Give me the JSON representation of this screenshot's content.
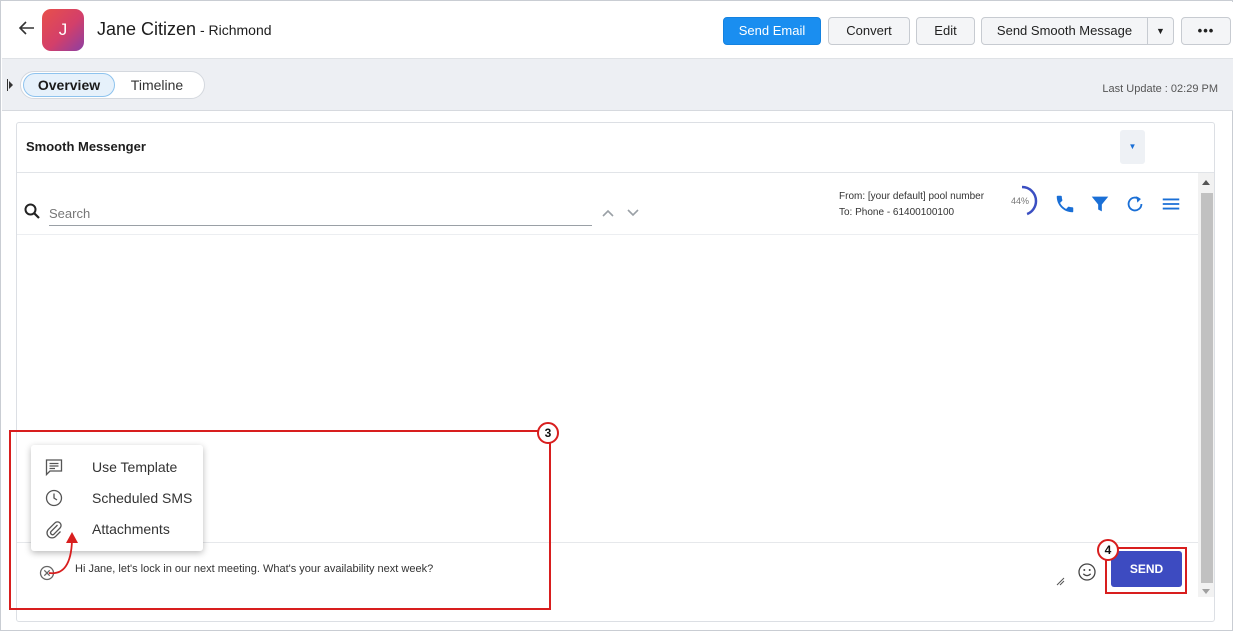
{
  "header": {
    "back_icon": "arrow-left-icon",
    "avatar_letter": "J",
    "contact_name": "Jane Citizen",
    "contact_location": " - Richmond",
    "buttons": {
      "send_email": "Send Email",
      "convert": "Convert",
      "edit": "Edit",
      "send_smooth_message": "Send Smooth Message",
      "more": "•••"
    },
    "accent_color": "#1a8ef0"
  },
  "tabs": {
    "items": [
      "Overview",
      "Timeline"
    ],
    "active": "Overview",
    "last_update": "Last Update : 02:29 PM"
  },
  "messenger": {
    "title": "Smooth Messenger",
    "search_placeholder": "Search",
    "from": "From: [your default] pool number",
    "to": "To: Phone - 61400100100",
    "progress_percent": 44,
    "progress_label": "44%",
    "tool_icons": [
      "phone-icon",
      "filter-icon",
      "refresh-icon",
      "menu-icon"
    ],
    "message_text": "Hi Jane, let's lock in our next meeting. What's your availability next week?",
    "send_label": "SEND",
    "send_color": "#3d4bc1"
  },
  "popup_menu": {
    "items": [
      {
        "label": "Use Template",
        "icon": "template-icon"
      },
      {
        "label": "Scheduled SMS",
        "icon": "clock-icon"
      },
      {
        "label": "Attachments",
        "icon": "paperclip-icon"
      }
    ]
  },
  "annotations": {
    "badge_compose": "3",
    "badge_send": "4",
    "color": "#d81e1e"
  }
}
